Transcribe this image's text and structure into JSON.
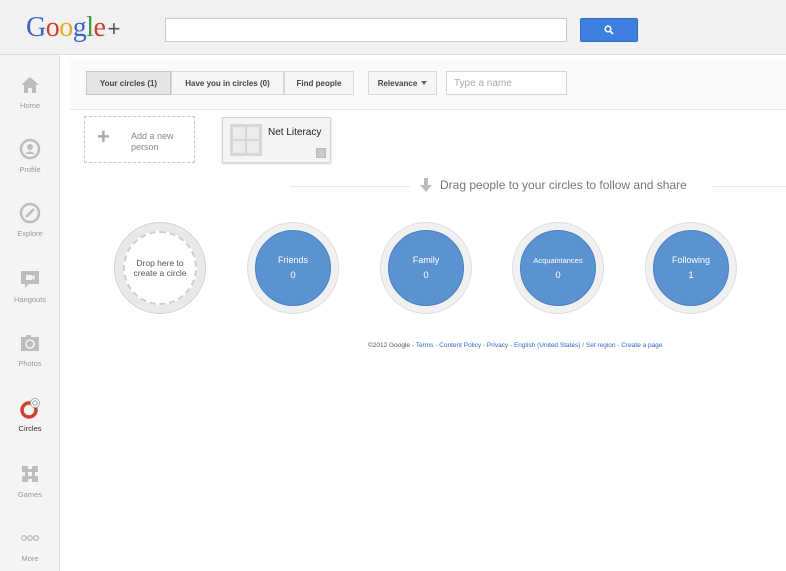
{
  "header": {
    "logo": "Google+",
    "search_value": ""
  },
  "nav": {
    "items": [
      {
        "label": "Home",
        "icon": "home-icon"
      },
      {
        "label": "Profile",
        "icon": "profile-icon"
      },
      {
        "label": "Explore",
        "icon": "explore-icon"
      },
      {
        "label": "Hangouts",
        "icon": "hangouts-icon"
      },
      {
        "label": "Photos",
        "icon": "photos-icon"
      },
      {
        "label": "Circles",
        "icon": "circles-icon",
        "active": true
      },
      {
        "label": "Games",
        "icon": "games-icon"
      },
      {
        "label": "More",
        "icon": "more-icon"
      }
    ]
  },
  "toolbar": {
    "tabs": [
      {
        "label": "Your circles (1)",
        "selected": true
      },
      {
        "label": "Have you in circles (0)",
        "selected": false
      },
      {
        "label": "Find people",
        "selected": false
      }
    ],
    "sort_label": "Relevance",
    "name_placeholder": "Type a name"
  },
  "people": {
    "add_label": "Add a new person",
    "cards": [
      {
        "name": "Net Literacy"
      }
    ]
  },
  "drag_hint": "Drag people to your circles to follow and share",
  "circles": {
    "drop_label": "Drop here to create a circle",
    "items": [
      {
        "name": "Friends",
        "count": "0"
      },
      {
        "name": "Family",
        "count": "0"
      },
      {
        "name": "Acquaintances",
        "count": "0"
      },
      {
        "name": "Following",
        "count": "1"
      }
    ]
  },
  "footer": {
    "copyright": "©2012 Google",
    "links": [
      "Terms",
      "Content Policy",
      "Privacy",
      "English (United States)",
      "Set region",
      "Create a page"
    ]
  },
  "colors": {
    "circle_blue": "#5b93d2",
    "search_blue": "#3c7fde",
    "active_red": "#d0402f"
  }
}
